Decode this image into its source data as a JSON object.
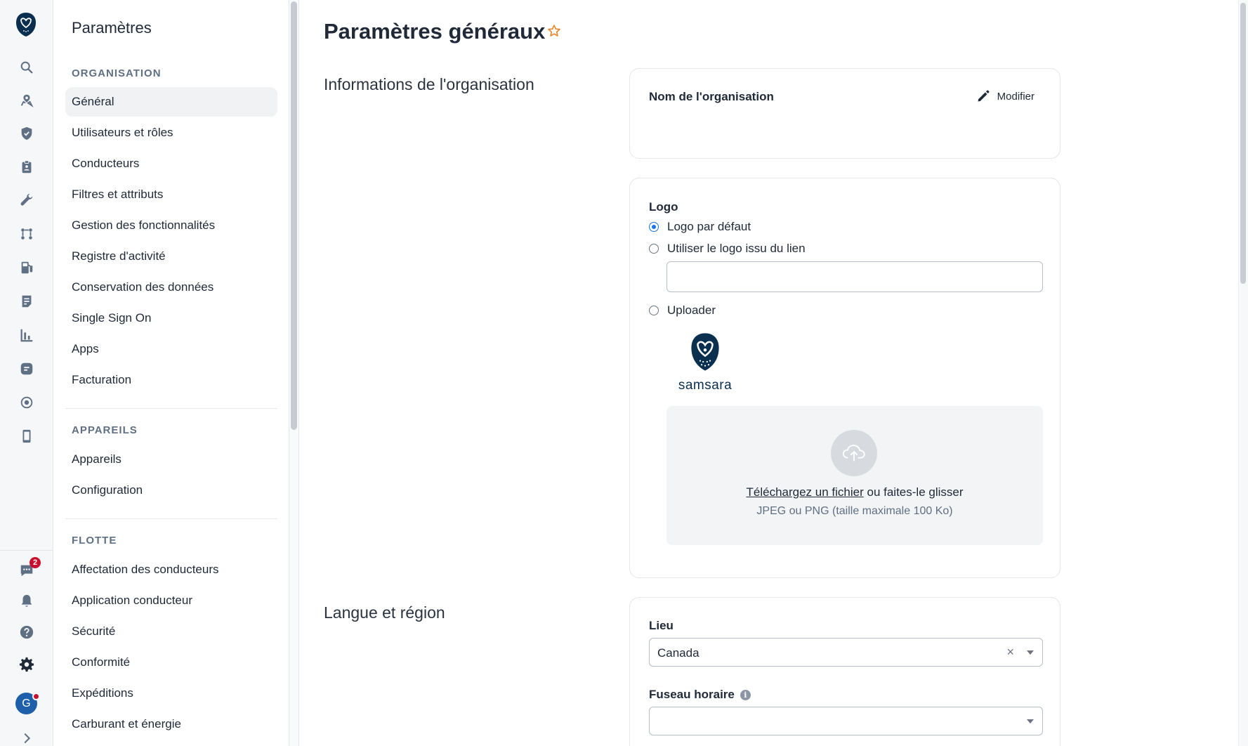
{
  "sidebar": {
    "title": "Paramètres",
    "sections": [
      {
        "heading": "ORGANISATION",
        "items": [
          "Général",
          "Utilisateurs et rôles",
          "Conducteurs",
          "Filtres et attributs",
          "Gestion des fonctionnalités",
          "Registre d'activité",
          "Conservation des données",
          "Single Sign On",
          "Apps",
          "Facturation"
        ]
      },
      {
        "heading": "APPAREILS",
        "items": [
          "Appareils",
          "Configuration"
        ]
      },
      {
        "heading": "FLOTTE",
        "items": [
          "Affectation des conducteurs",
          "Application conducteur",
          "Sécurité",
          "Conformité",
          "Expéditions",
          "Carburant et énergie"
        ]
      }
    ],
    "active_item": "Général"
  },
  "rail": {
    "notification_count": "2",
    "avatar_initial": "G",
    "icons": [
      "search-icon",
      "map-pin-icon",
      "shield-icon",
      "clipboard-icon",
      "wrench-icon",
      "routes-icon",
      "fuel-icon",
      "document-icon",
      "bar-chart-icon",
      "message-icon",
      "target-icon",
      "mobile-icon",
      "chat-icon",
      "bell-icon",
      "help-icon",
      "gear-icon",
      "chevron-right-icon"
    ]
  },
  "main": {
    "page_title": "Paramètres généraux",
    "org_section": {
      "label": "Informations de l'organisation",
      "name_field_label": "Nom de l'organisation",
      "edit_label": "Modifier",
      "logo": {
        "label": "Logo",
        "option_default": "Logo par défaut",
        "option_link": "Utiliser le logo issu du lien",
        "option_upload": "Uploader",
        "link_value": "",
        "brand_name": "samsara",
        "dropzone_link": "Téléchargez un fichier",
        "dropzone_text": " ou faites-le glisser",
        "dropzone_hint": "JPEG ou PNG (taille maximale 100 Ko)"
      }
    },
    "lang_section": {
      "label": "Langue et région",
      "location_label": "Lieu",
      "location_value": "Canada",
      "location_clear": "×",
      "timezone_label": "Fuseau horaire",
      "timezone_value": ""
    }
  },
  "colors": {
    "accent": "#1a73e8",
    "star": "#e8872b",
    "brand_navy": "#0b2f4e",
    "badge": "#c8102e"
  }
}
